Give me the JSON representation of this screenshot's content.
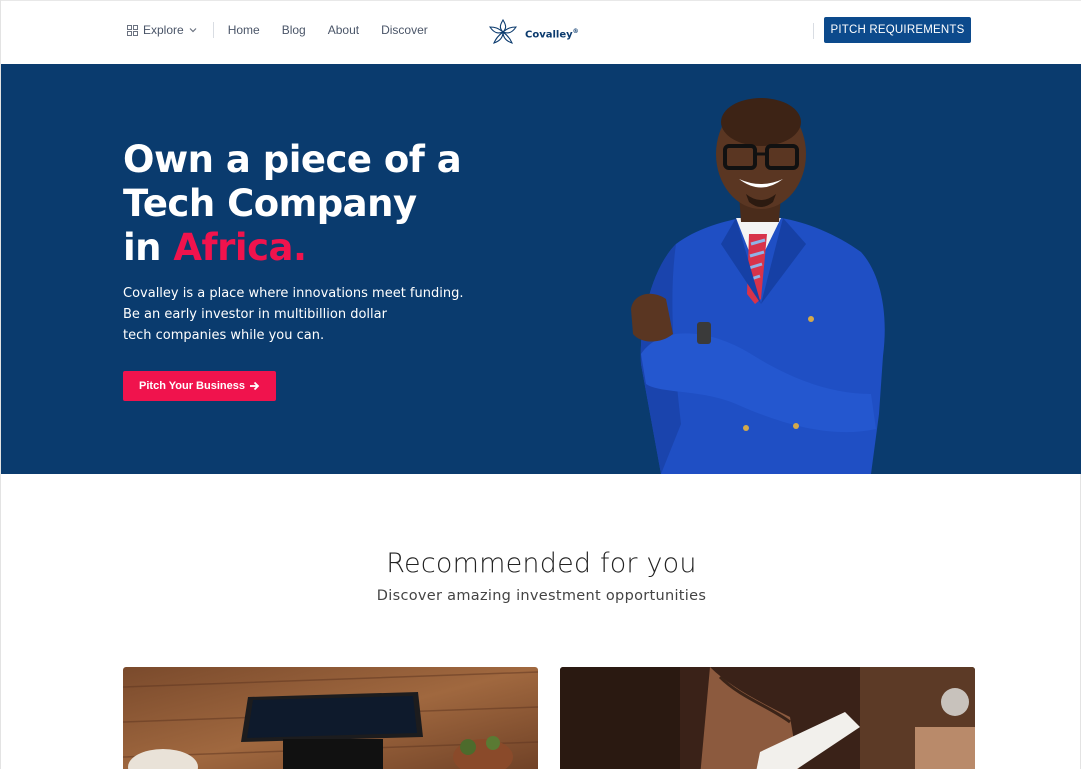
{
  "header": {
    "explore_label": "Explore",
    "nav": [
      "Home",
      "Blog",
      "About",
      "Discover"
    ],
    "logo_text": "Covalley",
    "logo_mark": "®",
    "cta_label": "PITCH REQUIREMENTS"
  },
  "hero": {
    "title_line1": "Own a piece of a",
    "title_line2": "Tech Company",
    "title_line3_prefix": "in ",
    "title_line3_accent": "Africa.",
    "desc_line1": "Covalley is a place where innovations meet funding.",
    "desc_line2": "Be an early investor in multibillion dollar",
    "desc_line3": "tech companies while you can.",
    "button_label": "Pitch Your Business",
    "button_icon": "arrow-right-icon"
  },
  "recommended": {
    "title": "Recommended for you",
    "subtitle": "Discover amazing investment opportunities"
  },
  "colors": {
    "brand_navy": "#0a3b6e",
    "button_blue": "#0c4a8c",
    "accent_pink": "#f0134d"
  }
}
